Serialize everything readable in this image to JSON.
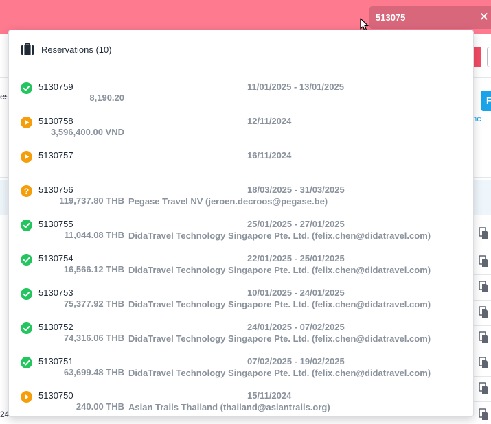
{
  "search": {
    "value": "513075"
  },
  "background": {
    "left_text": "es",
    "blue_button": "F",
    "link": "vanc",
    "bottom_text": "24"
  },
  "dropdown": {
    "title": "Reservations (10)",
    "header_icon": "briefcase-icon",
    "items": [
      {
        "id": "5130759",
        "dates": "11/01/2025 - 13/01/2025",
        "amount": "8,190.20",
        "client": "",
        "status": "confirmed"
      },
      {
        "id": "5130758",
        "dates": "12/11/2024",
        "amount": "3,596,400.00 VND",
        "client": "",
        "status": "in-progress"
      },
      {
        "id": "5130757",
        "dates": "16/11/2024",
        "amount": "",
        "client": "",
        "status": "in-progress"
      },
      {
        "id": "5130756",
        "dates": "18/03/2025 - 31/03/2025",
        "amount": "119,737.80 THB",
        "client": "Pegase Travel NV (jeroen.decroos@pegase.be)",
        "status": "unknown"
      },
      {
        "id": "5130755",
        "dates": "25/01/2025 - 27/01/2025",
        "amount": "11,044.08 THB",
        "client": "DidaTravel Technology Singapore Pte. Ltd. (felix.chen@didatravel.com)",
        "status": "confirmed"
      },
      {
        "id": "5130754",
        "dates": "22/01/2025 - 25/01/2025",
        "amount": "16,566.12 THB",
        "client": "DidaTravel Technology Singapore Pte. Ltd. (felix.chen@didatravel.com)",
        "status": "confirmed"
      },
      {
        "id": "5130753",
        "dates": "10/01/2025 - 24/01/2025",
        "amount": "75,377.92 THB",
        "client": "DidaTravel Technology Singapore Pte. Ltd. (felix.chen@didatravel.com)",
        "status": "confirmed"
      },
      {
        "id": "5130752",
        "dates": "24/01/2025 - 07/02/2025",
        "amount": "74,316.06 THB",
        "client": "DidaTravel Technology Singapore Pte. Ltd. (felix.chen@didatravel.com)",
        "status": "confirmed"
      },
      {
        "id": "5130751",
        "dates": "07/02/2025 - 19/02/2025",
        "amount": "63,699.48 THB",
        "client": "DidaTravel Technology Singapore Pte. Ltd. (felix.chen@didatravel.com)",
        "status": "confirmed"
      },
      {
        "id": "5130750",
        "dates": "15/11/2024",
        "amount": "240.00 THB",
        "client": "Asian Trails Thailand (thailand@asiantrails.org)",
        "status": "in-progress"
      }
    ]
  },
  "colors": {
    "topbar": "#fe7a8f",
    "search_bg": "#d8677c",
    "confirmed": "#22c55e",
    "in_progress": "#f59e0b",
    "unknown": "#f59e0b",
    "muted_text": "#8a929c"
  }
}
